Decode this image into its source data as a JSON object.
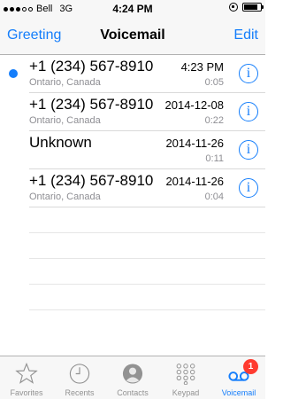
{
  "status_bar": {
    "carrier": "Bell",
    "network": "3G",
    "time": "4:24 PM"
  },
  "nav": {
    "left": "Greeting",
    "title": "Voicemail",
    "right": "Edit"
  },
  "voicemails": [
    {
      "caller": "+1 (234) 567-8910",
      "location": "Ontario, Canada",
      "date": "4:23 PM",
      "duration": "0:05",
      "unread": true
    },
    {
      "caller": "+1 (234) 567-8910",
      "location": "Ontario, Canada",
      "date": "2014-12-08",
      "duration": "0:22",
      "unread": false
    },
    {
      "caller": "Unknown",
      "location": "",
      "date": "2014-11-26",
      "duration": "0:11",
      "unread": false
    },
    {
      "caller": "+1 (234) 567-8910",
      "location": "Ontario, Canada",
      "date": "2014-11-26",
      "duration": "0:04",
      "unread": false
    }
  ],
  "tabs": [
    {
      "label": "Favorites",
      "icon": "star-icon",
      "active": false
    },
    {
      "label": "Recents",
      "icon": "clock-icon",
      "active": false
    },
    {
      "label": "Contacts",
      "icon": "person-icon",
      "active": false
    },
    {
      "label": "Keypad",
      "icon": "keypad-icon",
      "active": false
    },
    {
      "label": "Voicemail",
      "icon": "voicemail-icon",
      "active": true,
      "badge": "1"
    }
  ],
  "colors": {
    "accent": "#157efb",
    "badge": "#ff3b30",
    "secondary_text": "#8e8e93"
  }
}
